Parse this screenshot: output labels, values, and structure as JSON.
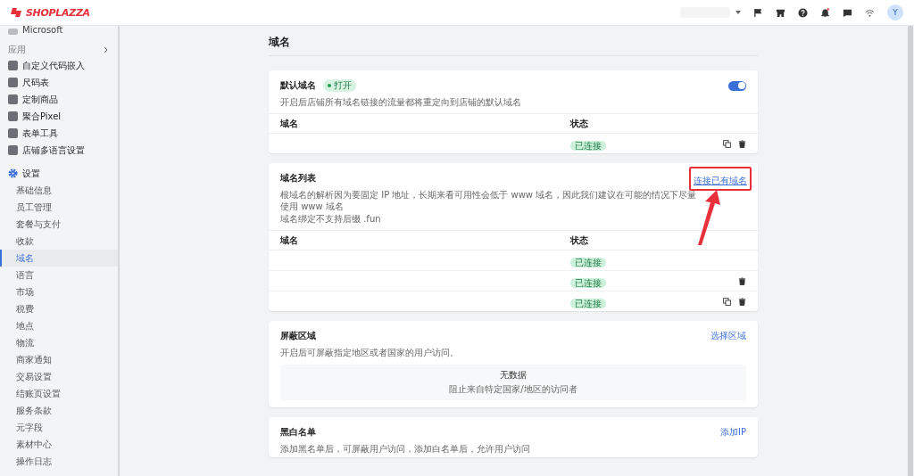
{
  "header": {
    "logo": "SHOPLAZZA",
    "avatar": "Y"
  },
  "sidebar": {
    "top_item": "Microsoft",
    "section_label": "应用",
    "apps": [
      {
        "label": "自定义代码嵌入"
      },
      {
        "label": "尺码表"
      },
      {
        "label": "定制商品"
      },
      {
        "label": "聚合Pixel"
      },
      {
        "label": "表单工具"
      },
      {
        "label": "店铺多语言设置"
      }
    ],
    "settings": {
      "label": "设置",
      "items": [
        {
          "label": "基础信息",
          "selected": false
        },
        {
          "label": "员工管理",
          "selected": false
        },
        {
          "label": "套餐与支付",
          "selected": false
        },
        {
          "label": "收款",
          "selected": false
        },
        {
          "label": "域名",
          "selected": true
        },
        {
          "label": "语言",
          "selected": false
        },
        {
          "label": "市场",
          "selected": false
        },
        {
          "label": "税费",
          "selected": false
        },
        {
          "label": "地点",
          "selected": false
        },
        {
          "label": "物流",
          "selected": false
        },
        {
          "label": "商家通知",
          "selected": false
        },
        {
          "label": "交易设置",
          "selected": false
        },
        {
          "label": "结账页设置",
          "selected": false
        },
        {
          "label": "服务条款",
          "selected": false
        },
        {
          "label": "元字段",
          "selected": false
        },
        {
          "label": "素材中心",
          "selected": false
        },
        {
          "label": "操作日志",
          "selected": false
        }
      ]
    }
  },
  "page_title": "域名",
  "default_domain": {
    "title": "默认域名",
    "badge": "打开",
    "enabled": true,
    "description": "开启后店铺所有域名链接的流量都将重定向到店铺的默认域名",
    "columns": [
      "域名",
      "状态"
    ],
    "rows": [
      {
        "status": "已连接",
        "copy": true,
        "delete": true
      }
    ]
  },
  "domain_list": {
    "title": "域名列表",
    "link": "连接已有域名",
    "description_lines": [
      "根域名的解析因为要固定 IP 地址，长期来看可用性会低于 www 域名，因此我们建议在可能的情况下尽量使用 www 域名",
      "域名绑定不支持后缀 .fun"
    ],
    "columns": [
      "域名",
      "状态"
    ],
    "rows": [
      {
        "status": "已连接",
        "copy": false,
        "delete": false
      },
      {
        "status": "已连接",
        "copy": false,
        "delete": true
      },
      {
        "status": "已连接",
        "copy": true,
        "delete": true
      }
    ]
  },
  "block_region": {
    "title": "屏蔽区域",
    "link": "选择区域",
    "description": "开启后可屏蔽指定地区或者国家的用户访问。",
    "empty_title": "无数据",
    "empty_text": "阻止来自特定国家/地区的访问者"
  },
  "blacklist": {
    "title": "黑白名单",
    "link": "添加IP",
    "description": "添加黑名单后，可屏蔽用户访问，添加白名单后，允许用户访问"
  }
}
